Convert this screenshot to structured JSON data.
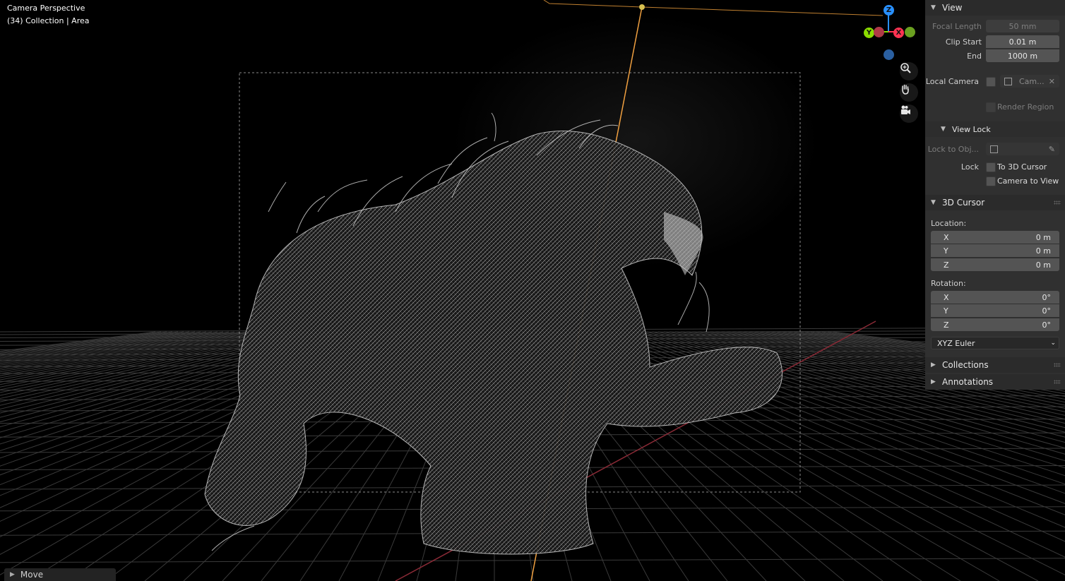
{
  "viewport": {
    "header_line1": "Camera Perspective",
    "header_line2": "(34) Collection | Area",
    "gizmo": {
      "z_label": "Z",
      "y_label": "Y",
      "x_label": "X",
      "colors": {
        "x": "#ff3352",
        "y": "#8bdc00",
        "z": "#2890ff"
      }
    },
    "nav_icons": [
      "zoom-icon",
      "pan-hand-icon",
      "camera-view-icon"
    ],
    "colors": {
      "camera_line": "#f0a040",
      "x_axis": "#8a2a36",
      "grid": "#3a3a3a"
    }
  },
  "npanel": {
    "view": {
      "title": "View",
      "focal_length_label": "Focal Length",
      "focal_length_value": "50 mm",
      "clip_start_label": "Clip Start",
      "clip_start_value": "0.01 m",
      "end_label": "End",
      "end_value": "1000 m",
      "local_camera_label": "Local Camera",
      "local_camera_value": "Cam...",
      "render_region_label": "Render Region",
      "view_lock": {
        "title": "View Lock",
        "lock_to_obj_label": "Lock to Obj...",
        "lock_label": "Lock",
        "to_3d_cursor_label": "To 3D Cursor",
        "camera_to_view_label": "Camera to View"
      }
    },
    "cursor": {
      "title": "3D Cursor",
      "location_label": "Location:",
      "location": [
        {
          "axis": "X",
          "value": "0 m"
        },
        {
          "axis": "Y",
          "value": "0 m"
        },
        {
          "axis": "Z",
          "value": "0 m"
        }
      ],
      "rotation_label": "Rotation:",
      "rotation": [
        {
          "axis": "X",
          "value": "0°"
        },
        {
          "axis": "Y",
          "value": "0°"
        },
        {
          "axis": "Z",
          "value": "0°"
        }
      ],
      "rotation_mode": "XYZ Euler"
    },
    "collections_title": "Collections",
    "annotations_title": "Annotations"
  },
  "status": {
    "last_operator": "Move"
  }
}
